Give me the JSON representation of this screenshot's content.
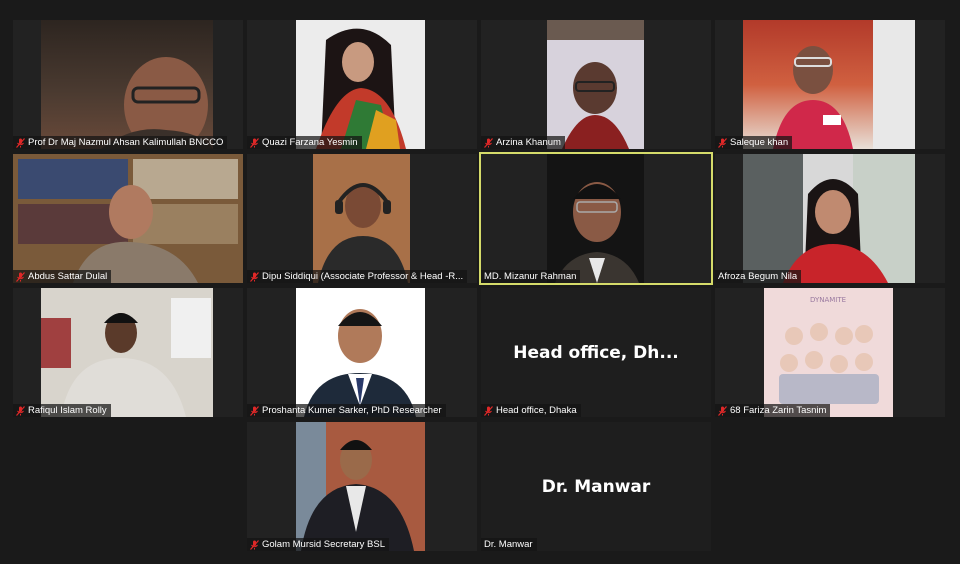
{
  "meeting": {
    "active_speaker_color": "#d5db6a",
    "muted_icon_color": "#e02828",
    "participants": [
      {
        "name": "Prof Dr Maj Nazmul Ahsan Kalimullah BNCCO",
        "muted": true
      },
      {
        "name": "Quazi Farzana Yesmin",
        "muted": true
      },
      {
        "name": "Arzina Khanum",
        "muted": true
      },
      {
        "name": "Saleque khan",
        "muted": true
      },
      {
        "name": "Abdus Sattar Dulal",
        "muted": true
      },
      {
        "name": "Dipu Siddiqui (Associate Professor & Head -R...",
        "muted": true
      },
      {
        "name": "MD. Mizanur Rahman",
        "muted": false,
        "active_speaker": true
      },
      {
        "name": "Afroza Begum Nila",
        "muted": false
      },
      {
        "name": "Rafiqul Islam Rolly",
        "muted": true
      },
      {
        "name": "Proshanta Kumer Sarker, PhD Researcher",
        "muted": true
      },
      {
        "name": "Head office, Dhaka",
        "display_text": "Head office, Dh...",
        "muted": true
      },
      {
        "name": "68 Fariza Zarin Tasnim",
        "muted": true
      },
      {
        "name": "Golam Mursid Secretary BSL",
        "muted": true
      },
      {
        "name": "Dr. Manwar",
        "display_text": "Dr. Manwar",
        "muted": false
      }
    ]
  }
}
